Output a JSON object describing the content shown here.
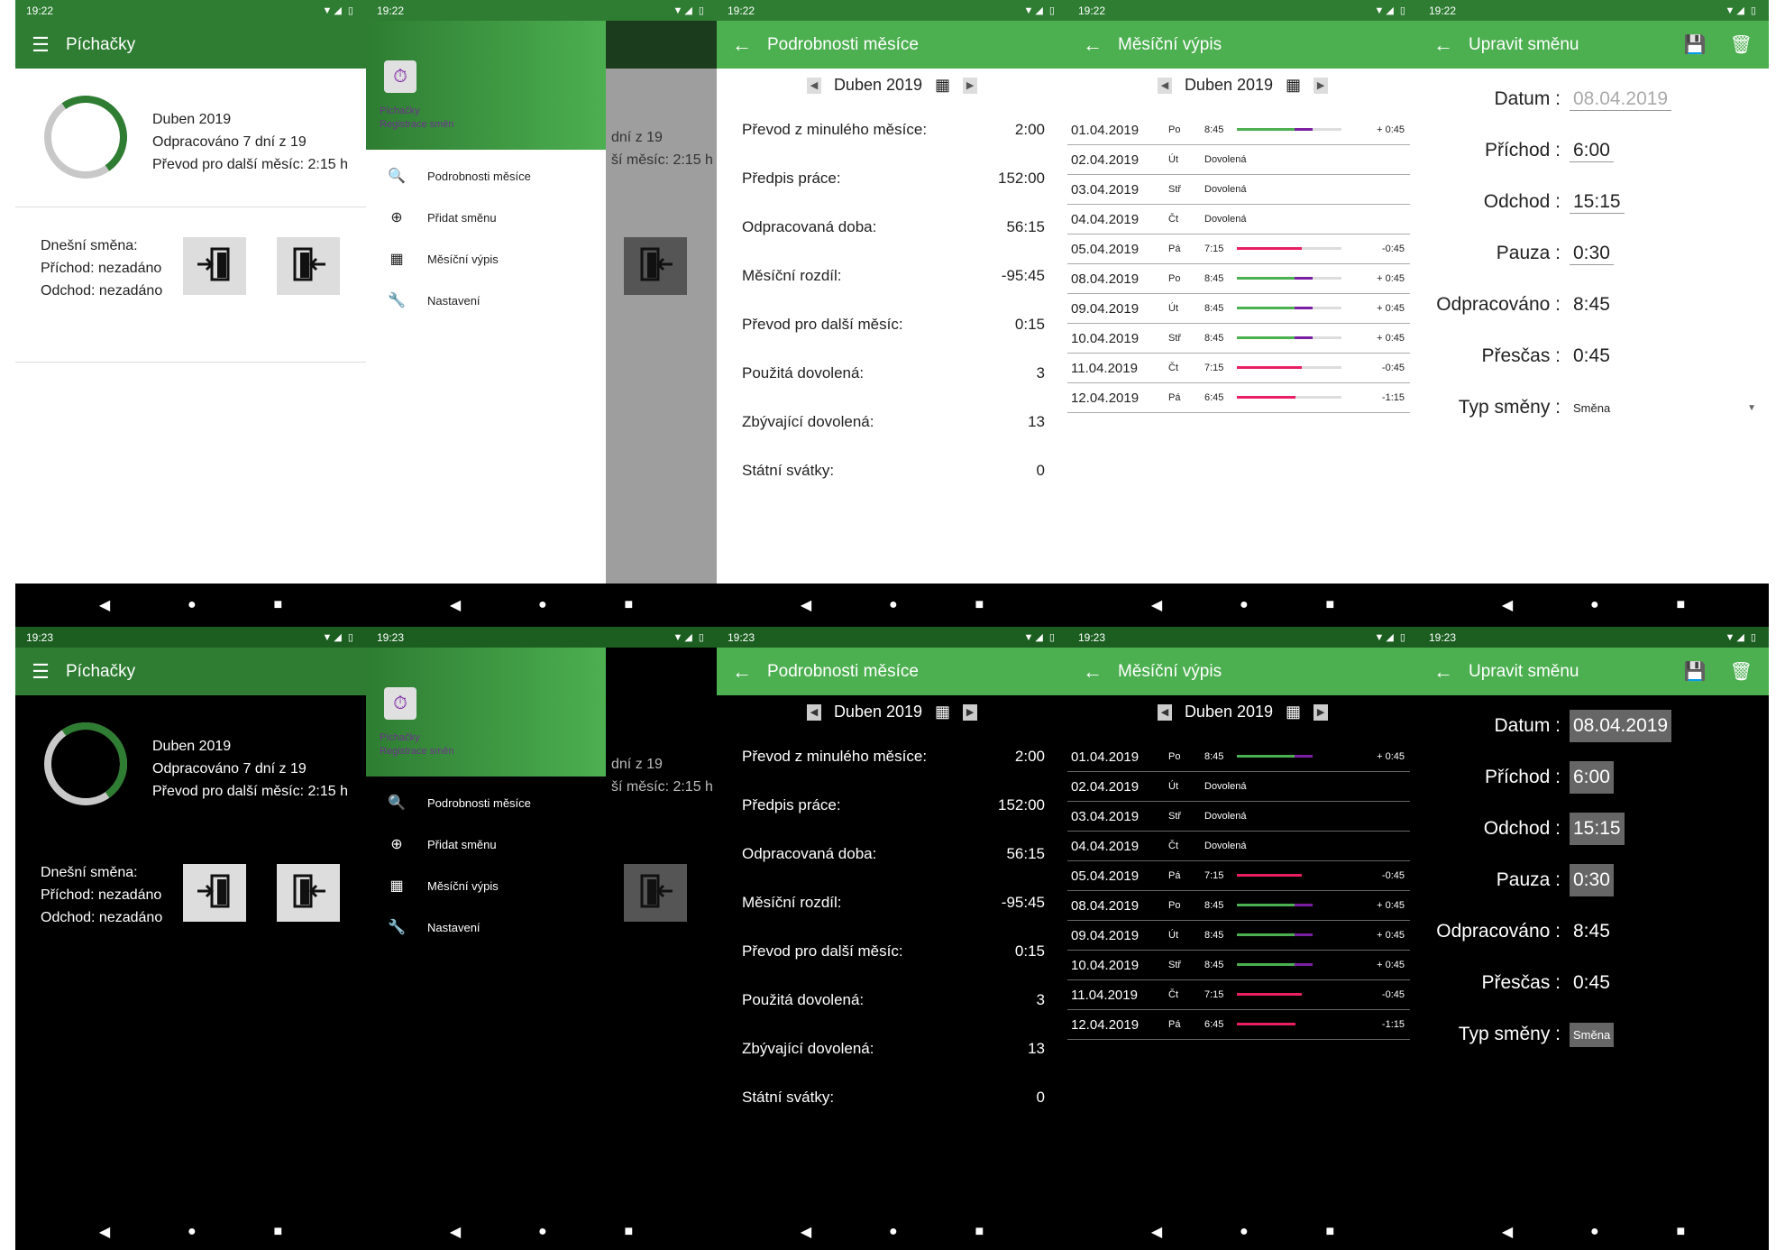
{
  "status": {
    "time_top": "19:22",
    "time_bottom": "19:23",
    "icons": "▼◢ ▯"
  },
  "main": {
    "title": "Píchačky",
    "month": "Duben 2019",
    "worked": "Odpracováno 7 dní z 19",
    "transfer": "Převod pro další měsíc: 2:15 h",
    "shift_title": "Dnešní směna:",
    "arrival": "Příchod: nezadáno",
    "departure": "Odchod: nezadáno"
  },
  "drawer": {
    "app_name": "Píchačky",
    "app_sub": "Registrace směn",
    "items": [
      {
        "label": "Podrobnosti měsíce",
        "icon": "magnifier-icon"
      },
      {
        "label": "Přidat směnu",
        "icon": "add-circle-icon"
      },
      {
        "label": "Měsíční výpis",
        "icon": "calendar-icon"
      },
      {
        "label": "Nastavení",
        "icon": "wrench-icon"
      }
    ],
    "peek_1": "dní z 19",
    "peek_2": "ší měsíc: 2:15 h"
  },
  "details": {
    "title": "Podrobnosti měsíce",
    "month": "Duben 2019",
    "rows": [
      {
        "label": "Převod z minulého měsíce:",
        "value": "2:00"
      },
      {
        "label": "Předpis práce:",
        "value": "152:00"
      },
      {
        "label": "Odpracovaná doba:",
        "value": "56:15"
      },
      {
        "label": "Měsíční rozdíl:",
        "value": "-95:45"
      },
      {
        "label": "Převod pro další měsíc:",
        "value": "0:15"
      },
      {
        "label": "Použitá dovolená:",
        "value": "3"
      },
      {
        "label": "Zbývající dovolená:",
        "value": "13"
      },
      {
        "label": "Státní svátky:",
        "value": "0"
      }
    ]
  },
  "monthly": {
    "title": "Měsíční výpis",
    "month": "Duben 2019",
    "rows": [
      {
        "date": "01.04.2019",
        "day": "Po",
        "time": "8:45",
        "kind": "g",
        "bar": 0.72,
        "diff": "+ 0:45"
      },
      {
        "date": "02.04.2019",
        "day": "Út",
        "time": "",
        "kind": "note",
        "note": "Dovolená",
        "diff": ""
      },
      {
        "date": "03.04.2019",
        "day": "Stř",
        "time": "",
        "kind": "note",
        "note": "Dovolená",
        "diff": ""
      },
      {
        "date": "04.04.2019",
        "day": "Čt",
        "time": "",
        "kind": "note",
        "note": "Dovolená",
        "diff": ""
      },
      {
        "date": "05.04.2019",
        "day": "Pá",
        "time": "7:15",
        "kind": "r",
        "bar": 0.62,
        "diff": "-0:45"
      },
      {
        "date": "08.04.2019",
        "day": "Po",
        "time": "8:45",
        "kind": "g",
        "bar": 0.72,
        "diff": "+ 0:45"
      },
      {
        "date": "09.04.2019",
        "day": "Út",
        "time": "8:45",
        "kind": "g",
        "bar": 0.72,
        "diff": "+ 0:45"
      },
      {
        "date": "10.04.2019",
        "day": "Stř",
        "time": "8:45",
        "kind": "g",
        "bar": 0.72,
        "diff": "+ 0:45"
      },
      {
        "date": "11.04.2019",
        "day": "Čt",
        "time": "7:15",
        "kind": "r",
        "bar": 0.62,
        "diff": "-0:45"
      },
      {
        "date": "12.04.2019",
        "day": "Pá",
        "time": "6:45",
        "kind": "r",
        "bar": 0.56,
        "diff": "-1:15"
      }
    ]
  },
  "edit": {
    "title": "Upravit směnu",
    "fields": [
      {
        "label": "Datum :",
        "value": "08.04.2019"
      },
      {
        "label": "Příchod :",
        "value": "6:00"
      },
      {
        "label": "Odchod :",
        "value": "15:15"
      },
      {
        "label": "Pauza :",
        "value": "0:30"
      },
      {
        "label": "Odpracováno :",
        "value": "8:45"
      },
      {
        "label": "Přesčas :",
        "value": "0:45"
      },
      {
        "label": "Typ směny :",
        "value": "Směna"
      }
    ]
  },
  "colors": {
    "primary_dark": "#2e7d32",
    "primary": "#4caf50",
    "accent": "#7b1fa2",
    "negative": "#e91e63"
  }
}
